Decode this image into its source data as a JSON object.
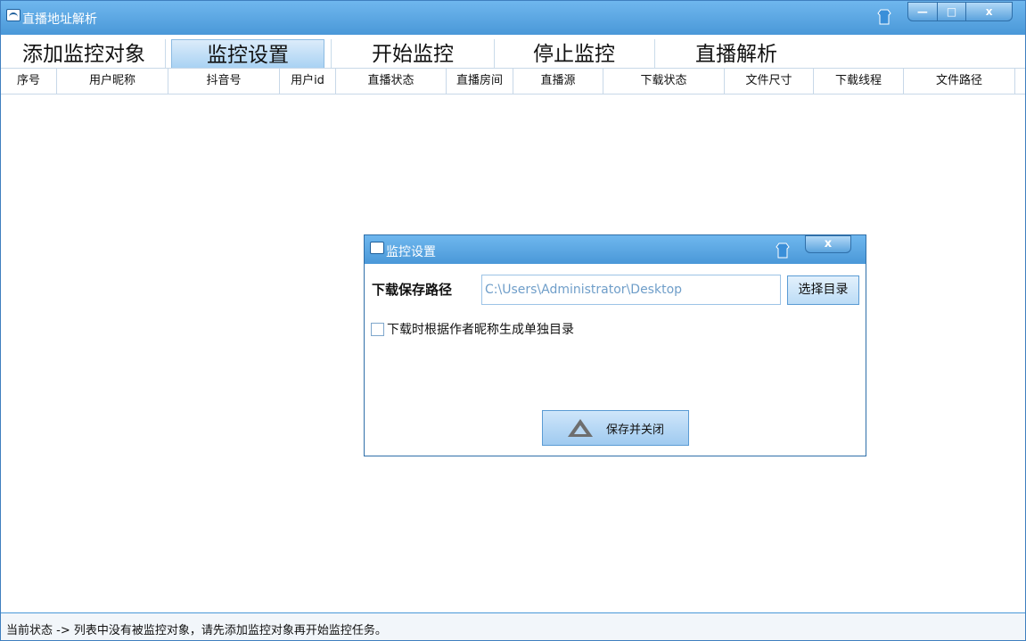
{
  "window": {
    "title": "直播地址解析",
    "minimize_glyph": "—",
    "maximize_glyph": "□",
    "close_glyph": "x",
    "icons": {
      "app": "app-logo-icon",
      "skin": "skin-shirt-icon"
    }
  },
  "tabs": [
    {
      "label": "添加监控对象"
    },
    {
      "label": "监控设置"
    },
    {
      "label": "开始监控"
    },
    {
      "label": "停止监控"
    },
    {
      "label": "直播解析"
    }
  ],
  "columns": [
    {
      "label": "序号"
    },
    {
      "label": "用户昵称"
    },
    {
      "label": "抖音号"
    },
    {
      "label": "用户id"
    },
    {
      "label": "直播状态"
    },
    {
      "label": "直播房间"
    },
    {
      "label": "直播源"
    },
    {
      "label": "下载状态"
    },
    {
      "label": "文件尺寸"
    },
    {
      "label": "下载线程"
    },
    {
      "label": "文件路径"
    }
  ],
  "dialog": {
    "title": "监控设置",
    "close_glyph": "x",
    "path_label": "下载保存路径",
    "path_value": "C:\\Users\\Administrator\\Desktop",
    "choose_label": "选择目录",
    "checkbox_label": "下载时根据作者昵称生成单独目录",
    "checkbox_checked": false,
    "save_label": "保存并关闭",
    "icons": {
      "save": "warning-triangle-icon"
    }
  },
  "status": {
    "text": "当前状态 -> 列表中没有被监控对象，请先添加监控对象再开始监控任务。"
  },
  "colors": {
    "titlebar": "#4a98d8",
    "accent": "#6fb7ee",
    "border": "#2f6fa9"
  }
}
